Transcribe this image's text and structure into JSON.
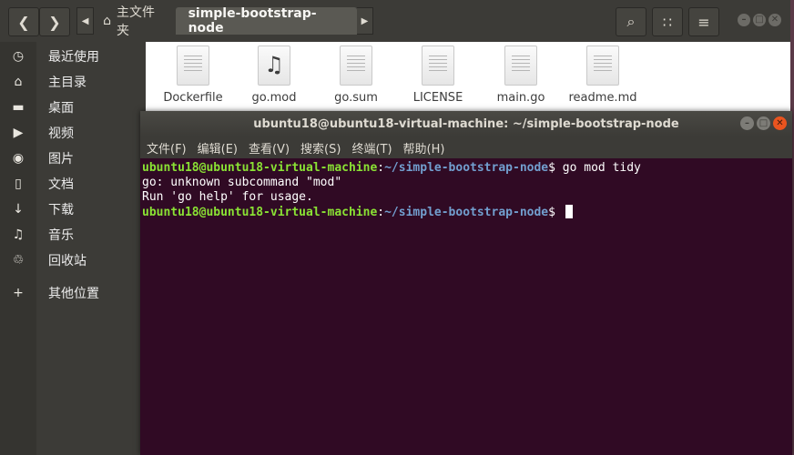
{
  "file_manager": {
    "breadcrumb": {
      "home_label": "主文件夹",
      "current_folder": "simple-bootstrap-node"
    },
    "sidebar": {
      "items": [
        {
          "icon": "clock-icon",
          "label": "最近使用"
        },
        {
          "icon": "home-icon",
          "label": "主目录"
        },
        {
          "icon": "folder-icon",
          "label": "桌面"
        },
        {
          "icon": "video-icon",
          "label": "视频"
        },
        {
          "icon": "camera-icon",
          "label": "图片"
        },
        {
          "icon": "document-icon",
          "label": "文档"
        },
        {
          "icon": "download-icon",
          "label": "下载"
        },
        {
          "icon": "music-icon",
          "label": "音乐"
        },
        {
          "icon": "trash-icon",
          "label": "回收站"
        },
        {
          "icon": "plus-icon",
          "label": "其他位置"
        }
      ]
    },
    "files": [
      {
        "name": "Dockerfile",
        "type": "text"
      },
      {
        "name": "go.mod",
        "type": "music"
      },
      {
        "name": "go.sum",
        "type": "text"
      },
      {
        "name": "LICENSE",
        "type": "text"
      },
      {
        "name": "main.go",
        "type": "text"
      },
      {
        "name": "readme.md",
        "type": "text"
      }
    ]
  },
  "terminal": {
    "title": "ubuntu18@ubuntu18-virtual-machine: ~/simple-bootstrap-node",
    "menu": [
      "文件(F)",
      "编辑(E)",
      "查看(V)",
      "搜索(S)",
      "终端(T)",
      "帮助(H)"
    ],
    "lines": [
      {
        "kind": "prompt",
        "user": "ubuntu18@ubuntu18-virtual-machine",
        "sep": ":",
        "path": "~/simple-bootstrap-node",
        "symbol": "$ ",
        "command": "go mod tidy"
      },
      {
        "kind": "output",
        "text": "go: unknown subcommand \"mod\""
      },
      {
        "kind": "output",
        "text": "Run 'go help' for usage."
      },
      {
        "kind": "prompt",
        "user": "ubuntu18@ubuntu18-virtual-machine",
        "sep": ":",
        "path": "~/simple-bootstrap-node",
        "symbol": "$ ",
        "command": ""
      }
    ]
  },
  "colors": {
    "terminal_bg": "#300a24",
    "prompt_user": "#8ae234",
    "prompt_path": "#729fcf",
    "close_button": "#e9541f"
  }
}
